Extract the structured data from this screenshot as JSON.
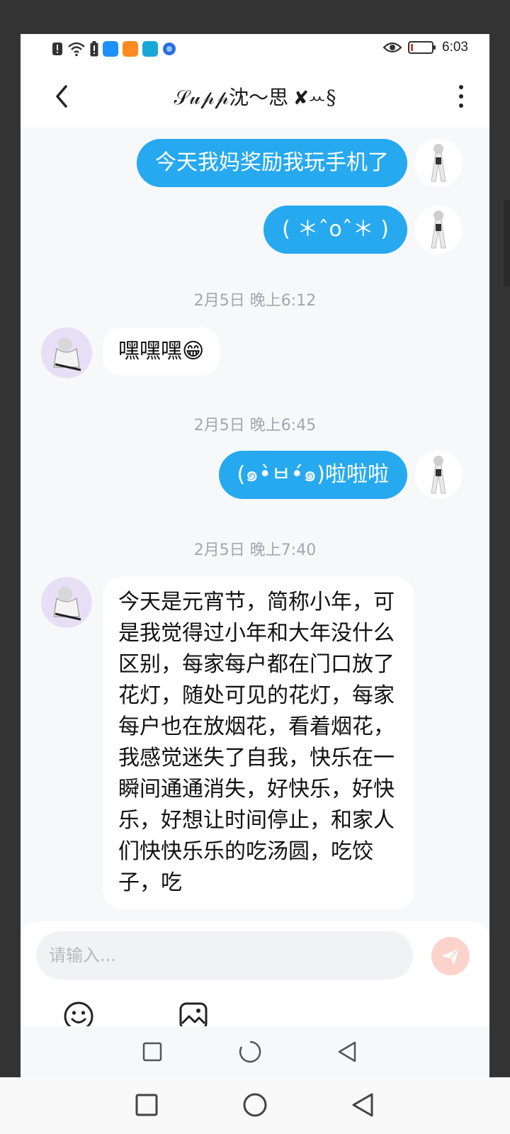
{
  "status_bar": {
    "time": "6:03",
    "icons": [
      "sim-alert-icon",
      "wifi-icon",
      "battery-alert-icon",
      "app-q-icon",
      "app-video-icon",
      "app-book-icon",
      "app-browser-icon",
      "eye-icon",
      "battery-icon"
    ]
  },
  "header": {
    "title": "𝒮𝓊𝓅𝓅沈～思 ✘ꕀ§",
    "back_icon": "back-arrow-icon",
    "more_icon": "more-vertical-icon"
  },
  "messages": [
    {
      "side": "out",
      "text": "今天我妈奖励我玩手机了"
    },
    {
      "side": "out",
      "text": "( ＊ˆoˆ＊ )"
    },
    {
      "type": "timestamp",
      "text": "2月5日 晚上6:12"
    },
    {
      "side": "in",
      "text": "嘿嘿嘿😁"
    },
    {
      "type": "timestamp",
      "text": "2月5日 晚上6:45"
    },
    {
      "side": "out",
      "text": "(๑•̀ㅂ•́๑)啦啦啦"
    },
    {
      "type": "timestamp",
      "text": "2月5日 晚上7:40"
    },
    {
      "side": "in",
      "text": "今天是元宵节，简称小年，可是我觉得过小年和大年没什么区别，每家每户都在门口放了花灯，随处可见的花灯，每家每户也在放烟花，看着烟花，我感觉迷失了自我，快乐在一瞬间通通消失，好快乐，好快乐，好想让时间停止，和家人们快快乐乐的吃汤圆，吃饺子，吃"
    }
  ],
  "input": {
    "placeholder": "请输入...",
    "value": ""
  },
  "colors": {
    "outgoing_bubble": "#27a9f0",
    "send_button": "#fbd3cb",
    "background": "#f7f8fa"
  }
}
